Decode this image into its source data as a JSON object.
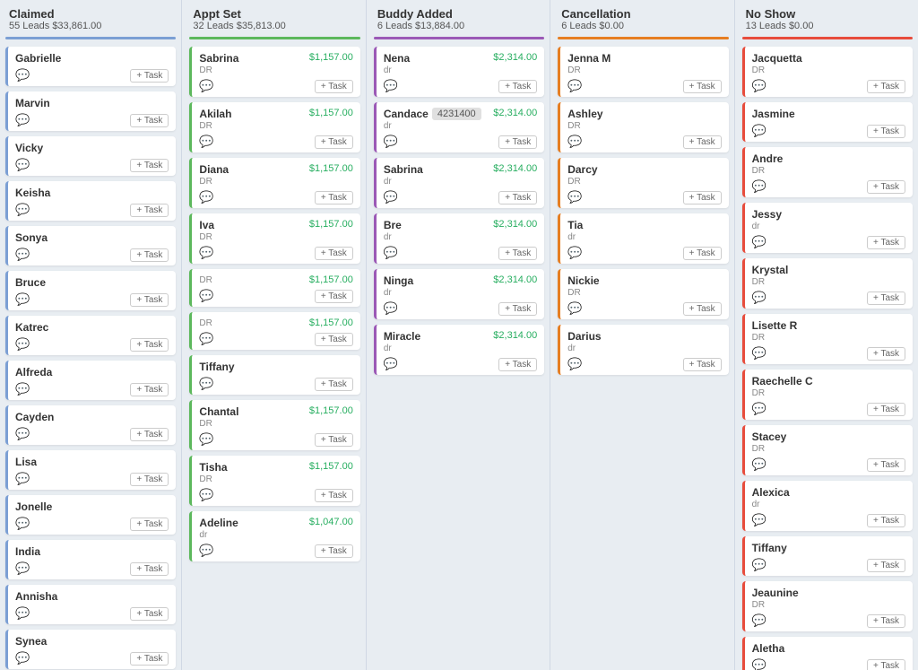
{
  "columns": [
    {
      "id": "claimed",
      "title": "Claimed",
      "leads": "55 Leads",
      "total": "$33,861.00",
      "divider": "blue",
      "cards": [
        {
          "name": "Gabrielle",
          "tag": "",
          "sub": "",
          "money": "",
          "has_task": true
        },
        {
          "name": "Marvin",
          "tag": "",
          "sub": "",
          "money": "",
          "has_task": true
        },
        {
          "name": "Vicky",
          "tag": "",
          "sub": "",
          "money": "",
          "has_task": true
        },
        {
          "name": "Keisha",
          "tag": "",
          "sub": "",
          "money": "",
          "has_task": true
        },
        {
          "name": "Sonya",
          "tag": "",
          "sub": "",
          "money": "",
          "has_task": true
        },
        {
          "name": "Bruce",
          "tag": "",
          "sub": "",
          "money": "",
          "has_task": true
        },
        {
          "name": "Katrec",
          "tag": "",
          "sub": "",
          "money": "",
          "has_task": true
        },
        {
          "name": "Alfreda",
          "tag": "",
          "sub": "",
          "money": "",
          "has_task": true
        },
        {
          "name": "Cayden",
          "tag": "",
          "sub": "",
          "money": "",
          "has_task": true
        },
        {
          "name": "Lisa",
          "tag": "",
          "sub": "",
          "money": "",
          "has_task": true
        },
        {
          "name": "Jonelle",
          "tag": "",
          "sub": "",
          "money": "",
          "has_task": true
        },
        {
          "name": "India",
          "tag": "",
          "sub": "",
          "money": "",
          "has_task": true
        },
        {
          "name": "Annisha",
          "tag": "",
          "sub": "",
          "money": "",
          "has_task": true
        },
        {
          "name": "Synea",
          "tag": "",
          "sub": "",
          "money": "",
          "has_task": true
        }
      ]
    },
    {
      "id": "appt-set",
      "title": "Appt Set",
      "leads": "32 Leads",
      "total": "$35,813.00",
      "divider": "green",
      "cards": [
        {
          "name": "Sabrina",
          "tag": "",
          "sub": "DR",
          "money": "$1,157.00",
          "has_task": true
        },
        {
          "name": "Akilah",
          "tag": "",
          "sub": "DR",
          "money": "$1,157.00",
          "has_task": true
        },
        {
          "name": "Diana",
          "tag": "",
          "sub": "DR",
          "money": "$1,157.00",
          "has_task": true
        },
        {
          "name": "Iva",
          "tag": "",
          "sub": "DR",
          "money": "$1,157.00",
          "has_task": true
        },
        {
          "name": "",
          "tag": "",
          "sub": "DR",
          "money": "$1,157.00",
          "has_task": true
        },
        {
          "name": "",
          "tag": "",
          "sub": "DR",
          "money": "$1,157.00",
          "has_task": true
        },
        {
          "name": "Tiffany",
          "tag": "",
          "sub": "",
          "money": "",
          "has_task": true
        },
        {
          "name": "Chantal",
          "tag": "",
          "sub": "DR",
          "money": "$1,157.00",
          "has_task": true
        },
        {
          "name": "Tisha",
          "tag": "",
          "sub": "DR",
          "money": "$1,157.00",
          "has_task": true
        },
        {
          "name": "Adeline",
          "tag": "",
          "sub": "dr",
          "money": "$1,047.00",
          "has_task": true
        }
      ]
    },
    {
      "id": "buddy-added",
      "title": "Buddy Added",
      "leads": "6 Leads",
      "total": "$13,884.00",
      "divider": "purple",
      "cards": [
        {
          "name": "Nena",
          "tag": "",
          "sub": "dr",
          "money": "$2,314.00",
          "has_task": true
        },
        {
          "name": "Candace",
          "tag": "4231400",
          "sub": "dr",
          "money": "$2,314.00",
          "has_task": true
        },
        {
          "name": "Sabrina",
          "tag": "",
          "sub": "dr",
          "money": "$2,314.00",
          "has_task": true
        },
        {
          "name": "Bre",
          "tag": "",
          "sub": "dr",
          "money": "$2,314.00",
          "has_task": true
        },
        {
          "name": "Ninga",
          "tag": "",
          "sub": "dr",
          "money": "$2,314.00",
          "has_task": true
        },
        {
          "name": "Miracle",
          "tag": "",
          "sub": "dr",
          "money": "$2,314.00",
          "has_task": true
        }
      ]
    },
    {
      "id": "cancellation",
      "title": "Cancellation",
      "leads": "6 Leads",
      "total": "$0.00",
      "divider": "orange",
      "cards": [
        {
          "name": "Jenna M",
          "tag": "",
          "sub": "DR",
          "money": "",
          "has_task": true
        },
        {
          "name": "Ashley",
          "tag": "",
          "sub": "DR",
          "money": "",
          "has_task": true
        },
        {
          "name": "Darcy",
          "tag": "",
          "sub": "DR",
          "money": "",
          "has_task": true
        },
        {
          "name": "Tia",
          "tag": "",
          "sub": "dr",
          "money": "",
          "has_task": true
        },
        {
          "name": "Nickie",
          "tag": "",
          "sub": "DR",
          "money": "",
          "has_task": true
        },
        {
          "name": "Darius",
          "tag": "",
          "sub": "dr",
          "money": "",
          "has_task": true
        }
      ]
    },
    {
      "id": "no-show",
      "title": "No Show",
      "leads": "13 Leads",
      "total": "$0.00",
      "divider": "red",
      "cards": [
        {
          "name": "Jacquetta",
          "tag": "",
          "sub": "DR",
          "money": "",
          "has_task": true
        },
        {
          "name": "Jasmine",
          "tag": "",
          "sub": "",
          "money": "",
          "has_task": true
        },
        {
          "name": "Andre",
          "tag": "",
          "sub": "DR",
          "money": "",
          "has_task": true
        },
        {
          "name": "Jessy",
          "tag": "",
          "sub": "dr",
          "money": "",
          "has_task": true
        },
        {
          "name": "Krystal",
          "tag": "",
          "sub": "DR",
          "money": "",
          "has_task": true
        },
        {
          "name": "Lisette R",
          "tag": "",
          "sub": "DR",
          "money": "",
          "has_task": true
        },
        {
          "name": "Raechelle C",
          "tag": "",
          "sub": "DR",
          "money": "",
          "has_task": true
        },
        {
          "name": "Stacey",
          "tag": "",
          "sub": "DR",
          "money": "",
          "has_task": true
        },
        {
          "name": "Alexica",
          "tag": "",
          "sub": "dr",
          "money": "",
          "has_task": true
        },
        {
          "name": "Tiffany",
          "tag": "",
          "sub": "",
          "money": "",
          "has_task": true
        },
        {
          "name": "Jeaunine",
          "tag": "",
          "sub": "DR",
          "money": "",
          "has_task": true
        },
        {
          "name": "Aletha",
          "tag": "",
          "sub": "",
          "money": "",
          "has_task": true
        }
      ]
    }
  ],
  "labels": {
    "task_btn": "+ Task",
    "leads_suffix": "Leads"
  }
}
